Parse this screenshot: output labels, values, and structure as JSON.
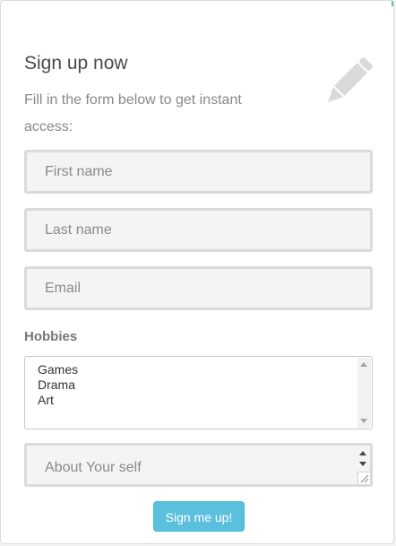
{
  "form": {
    "title": "Sign up now",
    "subtitle": "Fill in the form below to get instant access:",
    "header_icon": "pencil-icon",
    "fields": {
      "first_name": {
        "placeholder": "First name",
        "value": ""
      },
      "last_name": {
        "placeholder": "Last name",
        "value": ""
      },
      "email": {
        "placeholder": "Email",
        "value": ""
      }
    },
    "hobbies": {
      "label": "Hobbies",
      "options": [
        "Games",
        "Drama",
        "Art"
      ]
    },
    "about": {
      "placeholder": "About Your self"
    },
    "submit_label": "Sign me up!"
  },
  "colors": {
    "accent": "#5bc0de",
    "field_border": "#dadada",
    "field_background": "#f4f4f4",
    "icon": "#dadada"
  }
}
